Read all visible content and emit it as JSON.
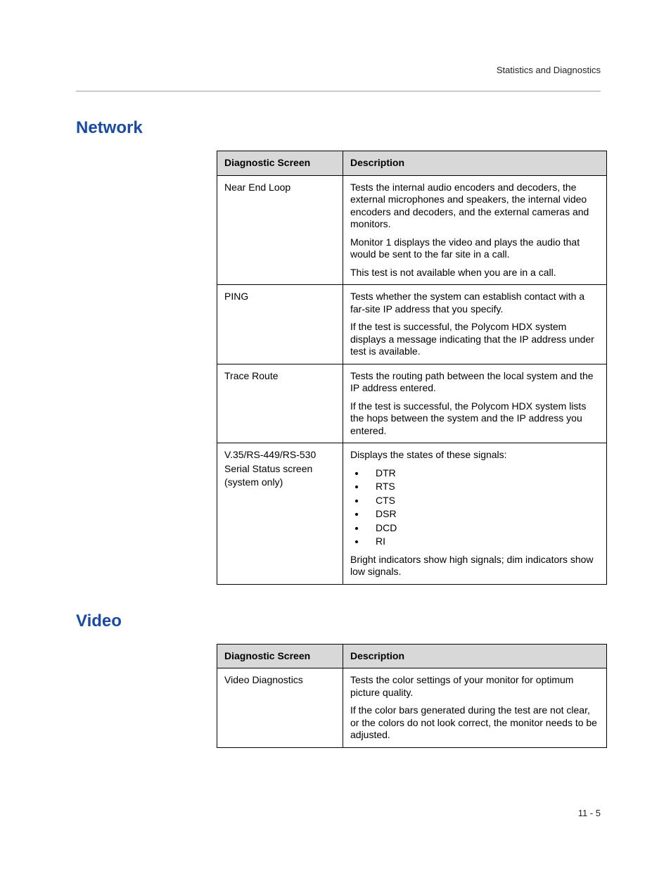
{
  "header": {
    "breadcrumb": "Statistics and Diagnostics"
  },
  "sections": {
    "network": {
      "heading": "Network",
      "cols": {
        "c1": "Diagnostic Screen",
        "c2": "Description"
      },
      "rows": [
        {
          "screen": "Near End Loop",
          "desc": {
            "p1": "Tests the internal audio encoders and decoders, the external microphones and speakers, the internal video encoders and decoders, and the external cameras and monitors.",
            "p2": "Monitor 1 displays the video and plays the audio that would be sent to the far site in a call.",
            "p3": "This test is not available when you are in a call."
          }
        },
        {
          "screen": "PING",
          "desc": {
            "p1": "Tests whether the system can establish contact with a far-site IP address that you specify.",
            "p2": "If the test is successful, the Polycom HDX system displays a message indicating that the IP address under test is available."
          }
        },
        {
          "screen": "Trace Route",
          "desc": {
            "p1": "Tests the routing path between the local system and the IP address entered.",
            "p2": "If the test is successful, the Polycom HDX system lists the hops between the system and the IP address you entered."
          }
        },
        {
          "screen": {
            "l1": "V.35/RS-449/RS-530",
            "l2": "Serial Status screen",
            "l3": "(system only)"
          },
          "desc": {
            "intro": "Displays the states of these signals:",
            "items": [
              "DTR",
              "RTS",
              "CTS",
              "DSR",
              "DCD",
              "RI"
            ],
            "outro": "Bright indicators show high signals; dim indicators show low signals."
          }
        }
      ]
    },
    "video": {
      "heading": "Video",
      "cols": {
        "c1": "Diagnostic Screen",
        "c2": "Description"
      },
      "rows": [
        {
          "screen": "Video Diagnostics",
          "desc": {
            "p1": "Tests the color settings of your monitor for optimum picture quality.",
            "p2": "If the color bars generated during the test are not clear, or the colors do not look correct, the monitor needs to be adjusted."
          }
        }
      ]
    }
  },
  "footer": {
    "page_num": "11 - 5"
  }
}
